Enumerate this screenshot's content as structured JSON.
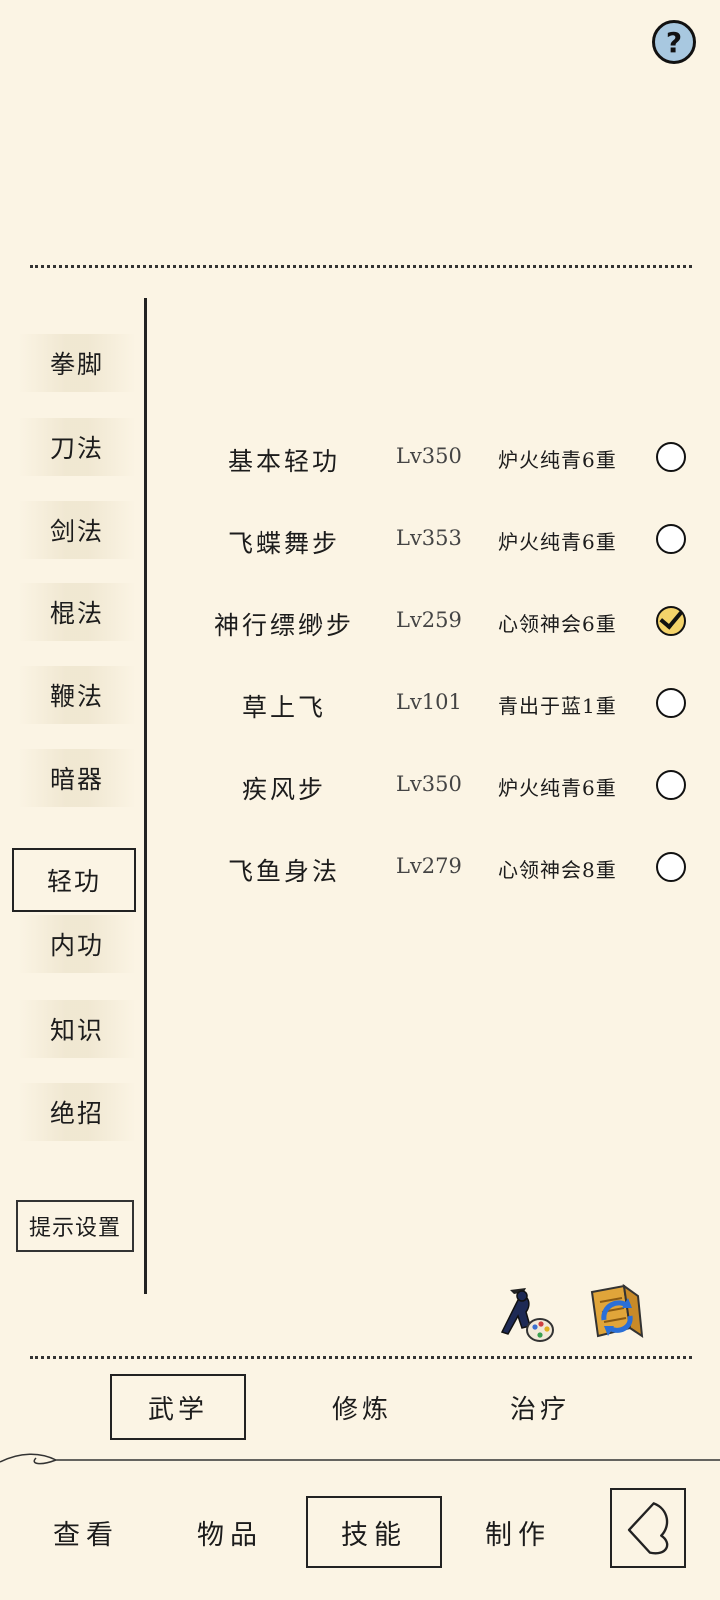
{
  "help": {
    "icon": "help-icon",
    "label": "?"
  },
  "categories": [
    {
      "label": "拳脚"
    },
    {
      "label": "刀法"
    },
    {
      "label": "剑法"
    },
    {
      "label": "棍法"
    },
    {
      "label": "鞭法"
    },
    {
      "label": "暗器"
    },
    {
      "label": "轻功",
      "active": true
    },
    {
      "label": "内功"
    },
    {
      "label": "知识"
    },
    {
      "label": "绝招"
    }
  ],
  "hint_settings_label": "提示设置",
  "skills": [
    {
      "name": "基本轻功",
      "level": "Lv350",
      "realm": "炉火纯青6重",
      "selected": false
    },
    {
      "name": "飞蝶舞步",
      "level": "Lv353",
      "realm": "炉火纯青6重",
      "selected": false
    },
    {
      "name": "神行缥缈步",
      "level": "Lv259",
      "realm": "心领神会6重",
      "selected": true
    },
    {
      "name": "草上飞",
      "level": "Lv101",
      "realm": "青出于蓝1重",
      "selected": false
    },
    {
      "name": "疾风步",
      "level": "Lv350",
      "realm": "炉火纯青6重",
      "selected": false
    },
    {
      "name": "飞鱼身法",
      "level": "Lv279",
      "realm": "心领神会8重",
      "selected": false
    }
  ],
  "action_icons": [
    "martial-artist-palette-icon",
    "book-swap-icon"
  ],
  "sub_tabs": [
    {
      "label": "武学",
      "active": true
    },
    {
      "label": "修炼"
    },
    {
      "label": "治疗"
    }
  ],
  "nav_tabs": [
    {
      "label": "查看"
    },
    {
      "label": "物品"
    },
    {
      "label": "技能",
      "active": true
    },
    {
      "label": "制作"
    }
  ],
  "back_icon": "back-arrow-icon"
}
